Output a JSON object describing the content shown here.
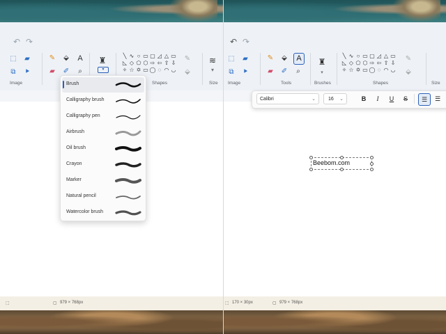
{
  "left": {
    "groups": {
      "image": "Image"
    },
    "shapes_label": "Shapes",
    "size_label": "Size",
    "text_tool_glyph": "A",
    "brush_menu": {
      "items": [
        {
          "label": "Brush",
          "selected": true
        },
        {
          "label": "Calligraphy brush"
        },
        {
          "label": "Calligraphy pen"
        },
        {
          "label": "Airbrush"
        },
        {
          "label": "Oil brush"
        },
        {
          "label": "Crayon"
        },
        {
          "label": "Marker"
        },
        {
          "label": "Natural pencil"
        },
        {
          "label": "Watercolor brush"
        }
      ]
    },
    "status": {
      "canvas_size": "979 × 768px"
    }
  },
  "right": {
    "groups": {
      "image": "Image",
      "tools": "Tools",
      "brushes": "Brushes",
      "shapes": "Shapes",
      "size": "Size"
    },
    "text_tool_glyph": "A",
    "text_toolbar": {
      "font": "Calibri",
      "size": "16",
      "bold": "B",
      "italic": "I",
      "underline": "U",
      "strikethrough": "S"
    },
    "canvas_text": "Beebom.com",
    "status": {
      "selection_size": "170 × 30px",
      "canvas_size": "979 × 768px"
    }
  },
  "shape_glyphs": [
    "╲",
    "∿",
    "○",
    "▭",
    "▢",
    "◿",
    "△",
    "▭",
    "◺",
    "◇",
    "⬠",
    "⬡",
    "⇨",
    "⇦",
    "⇧",
    "⇩",
    "✧",
    "☆",
    "✡",
    "▭",
    "◯",
    "◌",
    "◠",
    "◡"
  ],
  "colors": {
    "ribbon": "#eef2f7",
    "accent": "#2b5fb8",
    "status_bar": "#f4efe4"
  }
}
